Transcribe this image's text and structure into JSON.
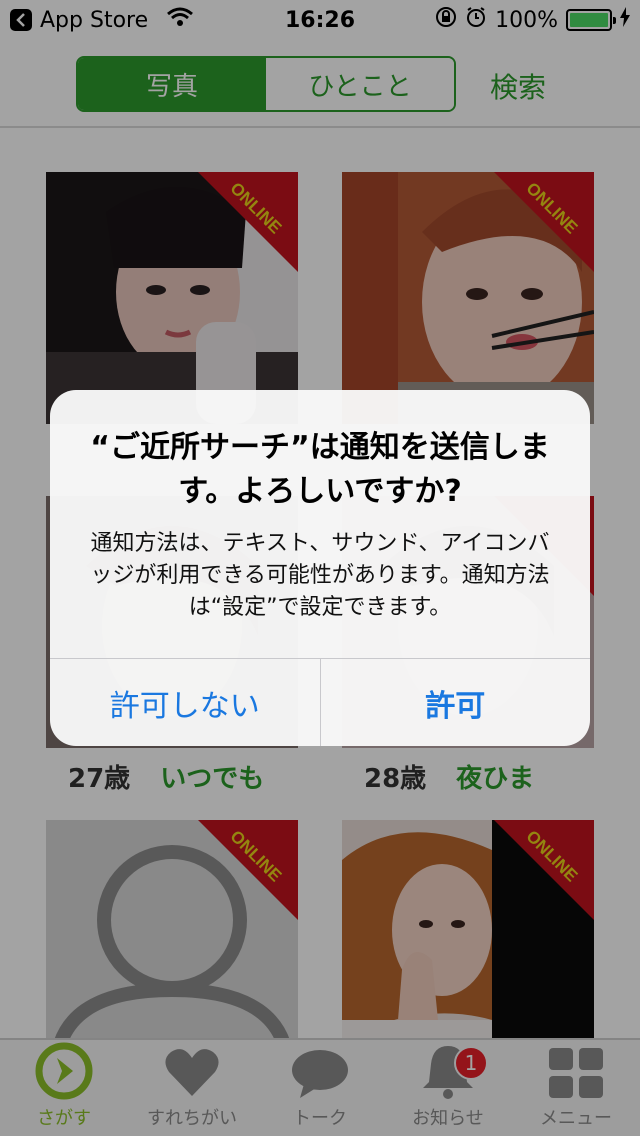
{
  "status_bar": {
    "back_app": "App Store",
    "time": "16:26",
    "battery": "100%",
    "battery_level": 1.0
  },
  "header": {
    "tabs": [
      {
        "label": "写真",
        "active": true
      },
      {
        "label": "ひとこと",
        "active": false
      }
    ],
    "search_label": "検索"
  },
  "cards": [
    {
      "badge": "ONLINE",
      "age": "",
      "availability": ""
    },
    {
      "badge": "ONLINE",
      "age": "",
      "availability": ""
    },
    {
      "badge": "",
      "age": "27歳",
      "availability": "いつでも"
    },
    {
      "badge": "",
      "age": "28歳",
      "availability": "夜ひま"
    },
    {
      "badge": "ONLINE",
      "age": "",
      "availability": ""
    },
    {
      "badge": "ONLINE",
      "age": "",
      "availability": ""
    }
  ],
  "alert": {
    "title": "“ご近所サーチ”は通知を送信します。よろしいですか?",
    "message": "通知方法は、テキスト、サウンド、アイコンバッジが利用できる可能性があります。通知方法は“設定”で設定できます。",
    "deny_label": "許可しない",
    "allow_label": "許可"
  },
  "tabbar": {
    "items": [
      {
        "label": "さがす",
        "icon": "search-compass-icon",
        "active": true
      },
      {
        "label": "すれちがい",
        "icon": "heart-icon",
        "active": false
      },
      {
        "label": "トーク",
        "icon": "speech-bubble-icon",
        "active": false
      },
      {
        "label": "お知らせ",
        "icon": "bell-icon",
        "active": false,
        "badge": "1"
      },
      {
        "label": "メニュー",
        "icon": "grid-menu-icon",
        "active": false
      }
    ]
  },
  "colors": {
    "accent_green": "#2c9a2c",
    "ribbon_red": "#c0141e",
    "ribbon_text": "#e8d21a",
    "alert_button_blue": "#1a78e0",
    "badge_red": "#e8202a"
  }
}
